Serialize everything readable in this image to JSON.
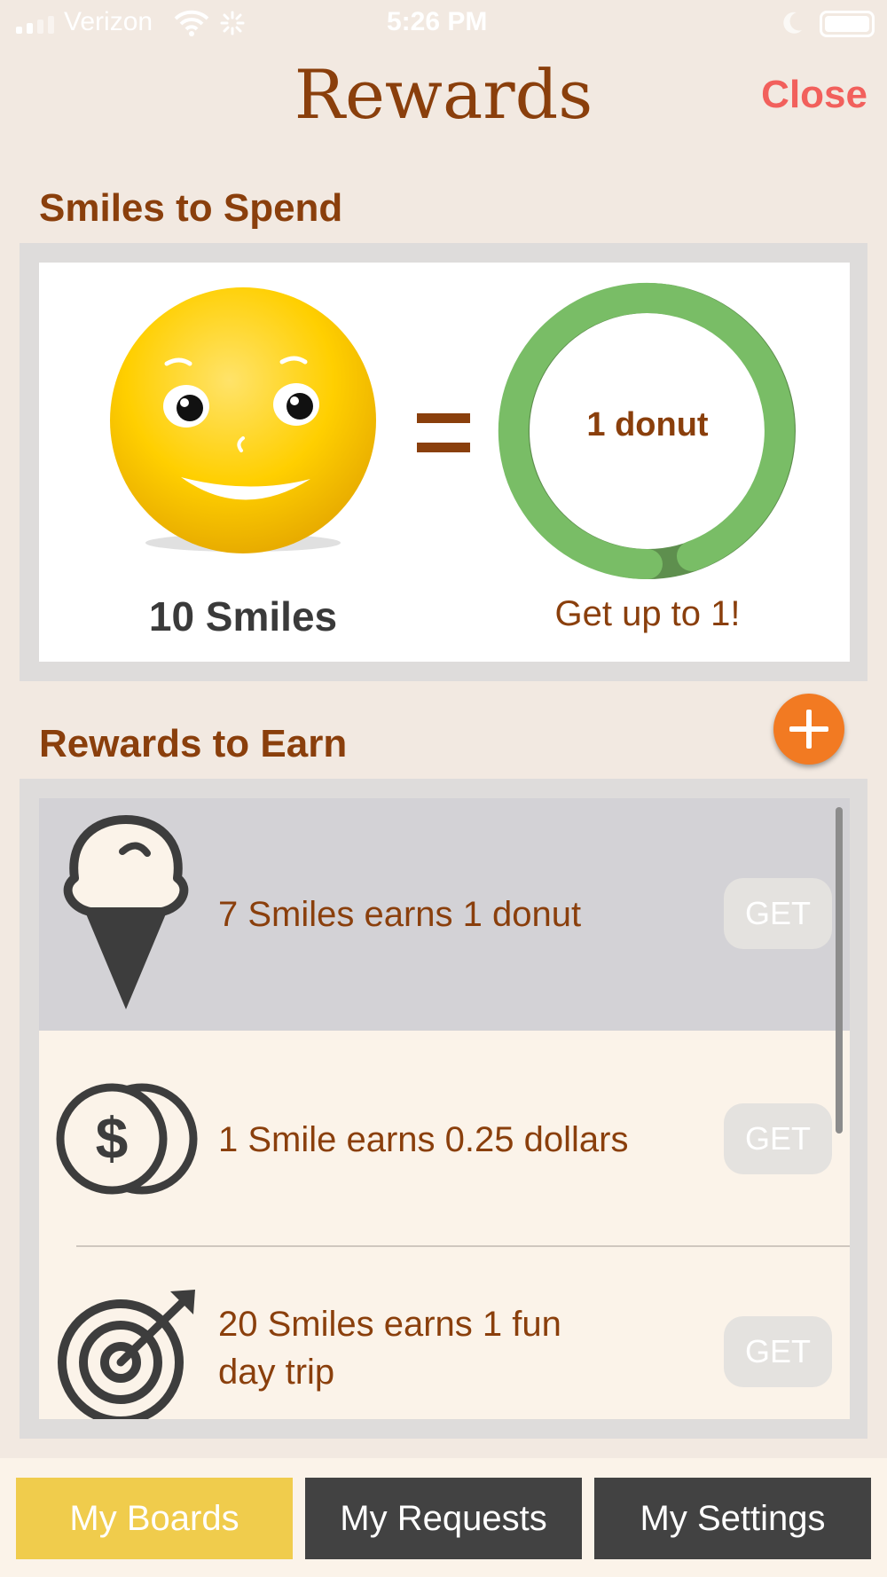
{
  "status_bar": {
    "carrier": "Verizon",
    "time": "5:26 PM"
  },
  "header": {
    "title": "Rewards",
    "close_label": "Close"
  },
  "spend": {
    "section_label": "Smiles to Spend",
    "smiles_count": "10 Smiles",
    "ring_label": "1 donut",
    "get_up_to": "Get up to 1!",
    "ring_color": "#79bd66"
  },
  "earn": {
    "section_label": "Rewards to Earn",
    "items": [
      {
        "icon": "ice-cream-icon",
        "text": "7 Smiles earns 1 donut",
        "button": "GET",
        "selected": true
      },
      {
        "icon": "coins-icon",
        "text": "1 Smile earns 0.25 dollars",
        "button": "GET",
        "selected": false
      },
      {
        "icon": "target-icon",
        "text_line1": "20 Smiles earns 1 fun",
        "text_line2": "day trip",
        "button": "GET",
        "selected": false
      }
    ]
  },
  "tabs": [
    {
      "label": "My Boards",
      "active": true
    },
    {
      "label": "My Requests",
      "active": false
    },
    {
      "label": "My Settings",
      "active": false
    }
  ],
  "colors": {
    "brand_brown": "#8a3f0c",
    "close_red": "#f2605c",
    "add_orange": "#f27a22",
    "tab_active": "#f0cc4c",
    "tab_inactive": "#424242"
  }
}
